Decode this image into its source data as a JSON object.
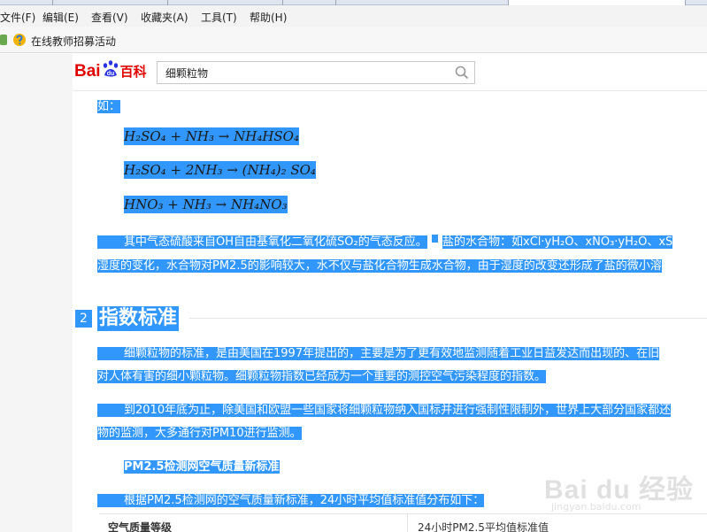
{
  "menubar": {
    "items": [
      "文件(F)",
      "编辑(E)",
      "查看(V)",
      "收藏夹(A)",
      "工具(T)",
      "帮助(H)"
    ]
  },
  "favorites": {
    "item": "在线教师招募活动"
  },
  "header": {
    "logo_bai": "Bai",
    "logo_du": "du",
    "logo_baike": "百科",
    "search_value": "细颗粒物"
  },
  "article": {
    "intro": "如：",
    "formulas": [
      "H₂SO₄ + NH₃ → NH₄HSO₄",
      "H₂SO₄ + 2NH₃ → (NH₄)₂ SO₄",
      "HNO₃ + NH₃ → NH₄NO₃"
    ],
    "para1_line1": "其中气态硫酸来自OH自由基氧化二氧化硫SO₂的气态反应。",
    "para1_line1_b": "盐的水合物：如xCl·yH₂O、xNO₃·yH₂O、xS",
    "para1_line2": "湿度的变化，水合物对PM2.5的影响较大，水不仅与盐化合物生成水合物，由于湿度的改变还形成了盐的微小溶",
    "section_number": "2",
    "section_title": "指数标准",
    "para2_line1": "细颗粒物的标准，是由美国在1997年提出的，主要是为了更有效地监测随着工业日益发达而出现的、在旧",
    "para2_line2": "对人体有害的细小颗粒物。细颗粒物指数已经成为一个重要的测控空气污染程度的指数。",
    "para3_line1": "到2010年底为止，除美国和欧盟一些国家将细颗粒物纳入国标并进行强制性限制外，世界上大部分国家都还",
    "para3_line2": "物的监测，大多通行对PM10进行监测。",
    "subheading": "PM2.5检测网空气质量新标准",
    "para4": "根据PM2.5检测网的空气质量新标准，24小时平均值标准值分布如下：",
    "table_header": [
      "空气质量等级",
      "24小时PM2.5平均值标准值"
    ]
  },
  "watermark": {
    "text": "Bai du 经验",
    "sub": "jingyan.baidu.com"
  },
  "colors": {
    "selection": "#3297fd",
    "baidu_red": "#e10602",
    "baidu_blue": "#2932e1"
  }
}
